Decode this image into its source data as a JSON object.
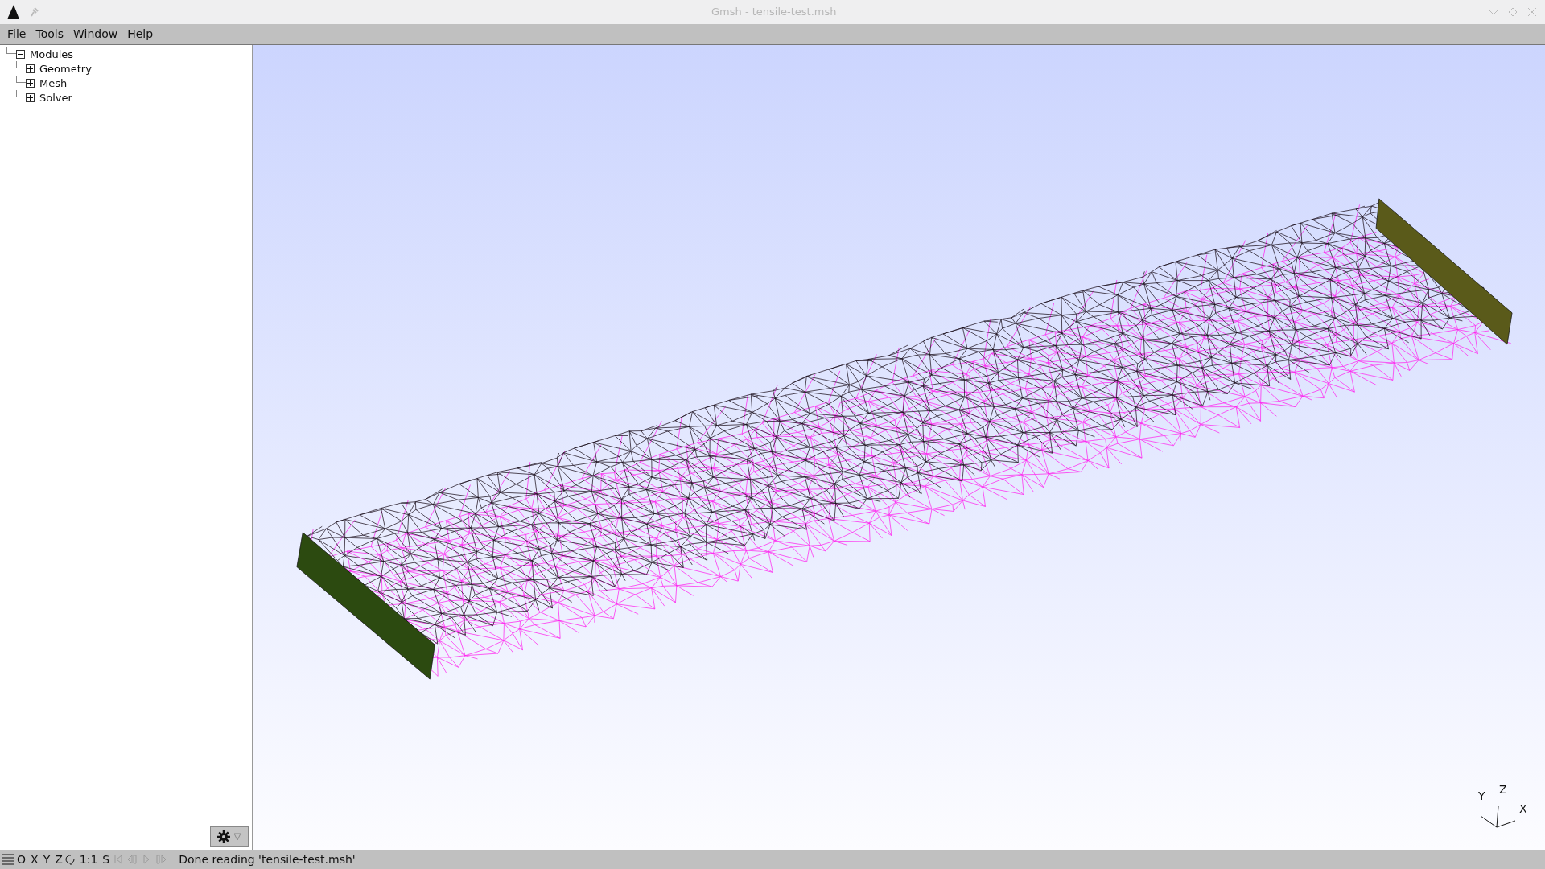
{
  "window": {
    "title": "Gmsh - tensile-test.msh"
  },
  "menu": [
    "File",
    "Tools",
    "Window",
    "Help"
  ],
  "tree": {
    "label": "Modules",
    "expanded": true,
    "children": [
      {
        "label": "Geometry",
        "expanded": false
      },
      {
        "label": "Mesh",
        "expanded": false
      },
      {
        "label": "Solver",
        "expanded": false
      }
    ]
  },
  "status_bar": {
    "view_buttons": [
      "O",
      "X",
      "Y",
      "Z"
    ],
    "scale_button": "1:1",
    "s_button": "S",
    "playback_disabled": true,
    "message": "Done reading 'tensile-test.msh'"
  },
  "axes": {
    "x": "X",
    "y": "Y",
    "z": "Z"
  }
}
